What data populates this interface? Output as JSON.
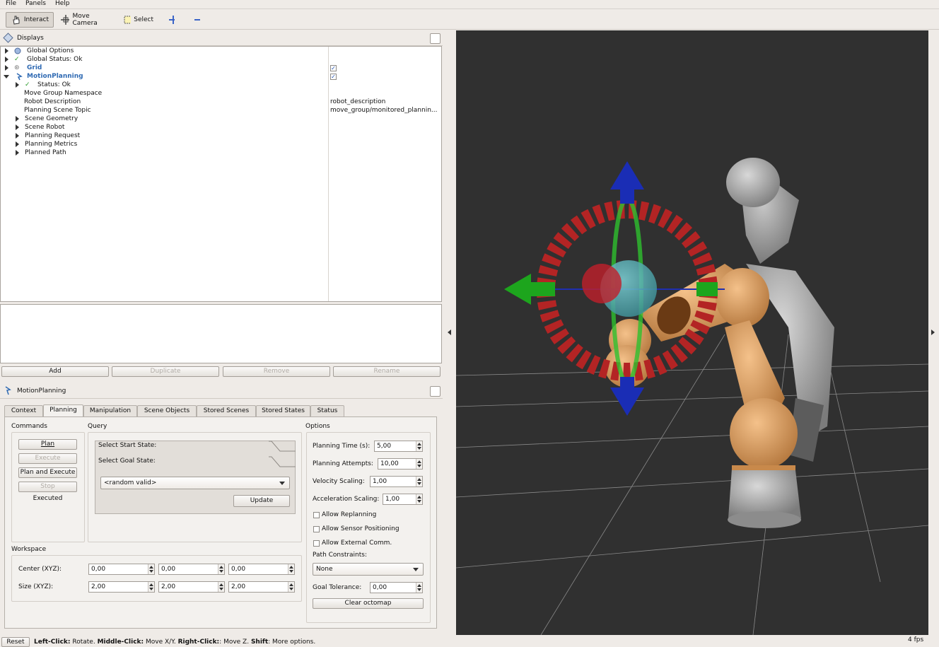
{
  "menu": {
    "file": "File",
    "panels": "Panels",
    "help": "Help"
  },
  "toolbar": {
    "interact": "Interact",
    "move_camera": "Move Camera",
    "select": "Select"
  },
  "displays": {
    "title": "Displays",
    "items": {
      "global_options": "Global Options",
      "global_status": "Global Status: Ok",
      "grid": "Grid",
      "motion_planning": "MotionPlanning",
      "status": "Status: Ok",
      "move_group_ns": "Move Group Namespace",
      "robot_description": "Robot Description",
      "planning_scene_topic": "Planning Scene Topic",
      "scene_geometry": "Scene Geometry",
      "scene_robot": "Scene Robot",
      "planning_request": "Planning Request",
      "planning_metrics": "Planning Metrics",
      "planned_path": "Planned Path"
    },
    "values": {
      "robot_description": "robot_description",
      "planning_scene_topic": "move_group/monitored_plannin..."
    },
    "buttons": {
      "add": "Add",
      "duplicate": "Duplicate",
      "remove": "Remove",
      "rename": "Rename"
    }
  },
  "motion_panel": {
    "title": "MotionPlanning",
    "tabs": [
      "Context",
      "Planning",
      "Manipulation",
      "Scene Objects",
      "Stored Scenes",
      "Stored States",
      "Status"
    ],
    "commands": {
      "title": "Commands",
      "plan": "Plan",
      "execute": "Execute",
      "plan_execute": "Plan and Execute",
      "stop": "Stop",
      "result": "Executed"
    },
    "query": {
      "title": "Query",
      "start": "Select Start State:",
      "goal": "Select Goal State:",
      "goal_value": "<random valid>",
      "update": "Update"
    },
    "workspace": {
      "title": "Workspace",
      "center_label": "Center (XYZ):",
      "size_label": "Size (XYZ):",
      "center": [
        "0,00",
        "0,00",
        "0,00"
      ],
      "size": [
        "2,00",
        "2,00",
        "2,00"
      ]
    },
    "options": {
      "title": "Options",
      "planning_time_label": "Planning Time (s):",
      "planning_time": "5,00",
      "attempts_label": "Planning Attempts:",
      "attempts": "10,00",
      "velocity_label": "Velocity Scaling:",
      "velocity": "1,00",
      "accel_label": "Acceleration Scaling:",
      "accel": "1,00",
      "allow_replanning": "Allow Replanning",
      "allow_sensor": "Allow Sensor Positioning",
      "allow_external": "Allow External Comm.",
      "path_constraints_label": "Path Constraints:",
      "path_constraints": "None",
      "goal_tolerance_label": "Goal Tolerance:",
      "goal_tolerance": "0,00",
      "clear_octomap": "Clear octomap"
    }
  },
  "status": {
    "reset": "Reset",
    "hint_left_key": "Left-Click:",
    "hint_left": " Rotate. ",
    "hint_mid_key": "Middle-Click:",
    "hint_mid": " Move X/Y. ",
    "hint_right_key": "Right-Click:",
    "hint_right": ": Move Z. ",
    "hint_shift_key": "Shift",
    "hint_shift": ": More options.",
    "fps": "4 fps"
  }
}
